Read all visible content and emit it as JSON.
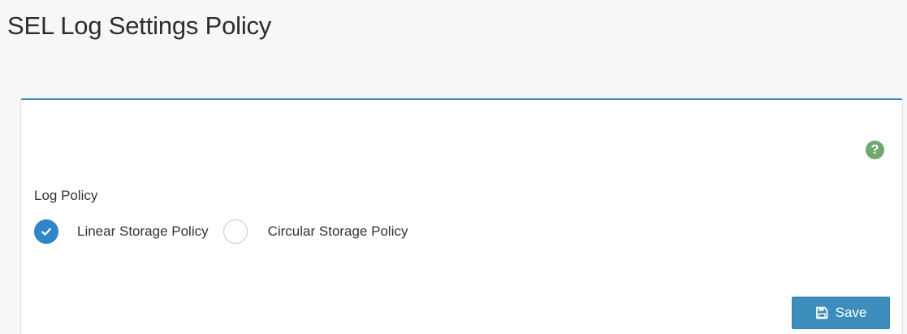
{
  "page": {
    "title": "SEL Log Settings Policy"
  },
  "panel": {
    "accent_color": "#3c8dbc",
    "help_icon": "question-circle-icon",
    "help_color": "#70a870"
  },
  "log_policy": {
    "label": "Log Policy",
    "options": [
      {
        "label": "Linear Storage Policy",
        "checked": true
      },
      {
        "label": "Circular Storage Policy",
        "checked": false
      }
    ],
    "checked_color": "#2f86c8"
  },
  "actions": {
    "save_label": "Save",
    "save_icon": "floppy-disk-icon",
    "save_color": "#3c8dbc"
  }
}
